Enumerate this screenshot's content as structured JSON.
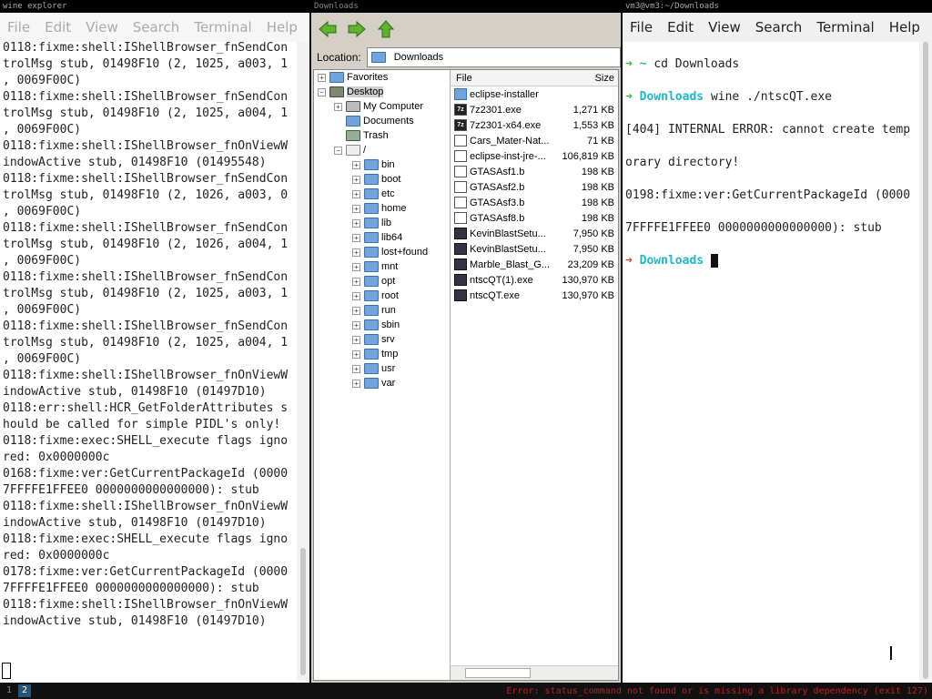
{
  "left_terminal": {
    "title": "wine explorer",
    "menu": [
      "File",
      "Edit",
      "View",
      "Search",
      "Terminal",
      "Help"
    ],
    "lines": [
      "0118:fixme:shell:IShellBrowser_fnSendCon",
      "trolMsg stub, 01498F10 (2, 1025, a003, 1",
      ", 0069F00C)",
      "0118:fixme:shell:IShellBrowser_fnSendCon",
      "trolMsg stub, 01498F10 (2, 1025, a004, 1",
      ", 0069F00C)",
      "0118:fixme:shell:IShellBrowser_fnOnViewW",
      "indowActive stub, 01498F10 (01495548)",
      "0118:fixme:shell:IShellBrowser_fnSendCon",
      "trolMsg stub, 01498F10 (2, 1026, a003, 0",
      ", 0069F00C)",
      "0118:fixme:shell:IShellBrowser_fnSendCon",
      "trolMsg stub, 01498F10 (2, 1026, a004, 1",
      ", 0069F00C)",
      "0118:fixme:shell:IShellBrowser_fnSendCon",
      "trolMsg stub, 01498F10 (2, 1025, a003, 1",
      ", 0069F00C)",
      "0118:fixme:shell:IShellBrowser_fnSendCon",
      "trolMsg stub, 01498F10 (2, 1025, a004, 1",
      ", 0069F00C)",
      "0118:fixme:shell:IShellBrowser_fnOnViewW",
      "indowActive stub, 01498F10 (01497D10)",
      "0118:err:shell:HCR_GetFolderAttributes s",
      "hould be called for simple PIDL's only!",
      "0118:fixme:exec:SHELL_execute flags igno",
      "red: 0x0000000c",
      "0168:fixme:ver:GetCurrentPackageId (0000",
      "7FFFFE1FFEE0 0000000000000000): stub",
      "0118:fixme:shell:IShellBrowser_fnOnViewW",
      "indowActive stub, 01498F10 (01497D10)",
      "0118:fixme:exec:SHELL_execute flags igno",
      "red: 0x0000000c",
      "0178:fixme:ver:GetCurrentPackageId (0000",
      "7FFFFE1FFEE0 0000000000000000): stub",
      "0118:fixme:shell:IShellBrowser_fnOnViewW",
      "indowActive stub, 01498F10 (01497D10)"
    ]
  },
  "explorer": {
    "title": "Downloads",
    "location_label": "Location:",
    "location_value": "Downloads",
    "tree": {
      "favorites": "Favorites",
      "desktop": "Desktop",
      "my_computer": "My Computer",
      "documents": "Documents",
      "trash": "Trash",
      "root": "/",
      "folders": [
        "bin",
        "boot",
        "etc",
        "home",
        "lib",
        "lib64",
        "lost+found",
        "mnt",
        "opt",
        "root",
        "run",
        "sbin",
        "srv",
        "tmp",
        "usr",
        "var"
      ]
    },
    "columns": {
      "file": "File",
      "size": "Size"
    },
    "files": [
      {
        "name": "eclipse-installer",
        "size": "",
        "icon": "folder"
      },
      {
        "name": "7z2301.exe",
        "size": "1,271 KB",
        "icon": "7z"
      },
      {
        "name": "7z2301-x64.exe",
        "size": "1,553 KB",
        "icon": "7z"
      },
      {
        "name": "Cars_Mater-Nat...",
        "size": "71 KB",
        "icon": "doc"
      },
      {
        "name": "eclipse-inst-jre-...",
        "size": "106,819 KB",
        "icon": "doc"
      },
      {
        "name": "GTASAsf1.b",
        "size": "198 KB",
        "icon": "doc"
      },
      {
        "name": "GTASAsf2.b",
        "size": "198 KB",
        "icon": "doc"
      },
      {
        "name": "GTASAsf3.b",
        "size": "198 KB",
        "icon": "doc"
      },
      {
        "name": "GTASAsf8.b",
        "size": "198 KB",
        "icon": "doc"
      },
      {
        "name": "KevinBlastSetu...",
        "size": "7,950 KB",
        "icon": "exe"
      },
      {
        "name": "KevinBlastSetu...",
        "size": "7,950 KB",
        "icon": "exe"
      },
      {
        "name": "Marble_Blast_G...",
        "size": "23,209 KB",
        "icon": "exe"
      },
      {
        "name": "ntscQT(1).exe",
        "size": "130,970 KB",
        "icon": "exe"
      },
      {
        "name": "ntscQT.exe",
        "size": "130,970 KB",
        "icon": "exe"
      }
    ]
  },
  "right_terminal": {
    "title": "vm3@vm3:~/Downloads",
    "menu": [
      "File",
      "Edit",
      "View",
      "Search",
      "Terminal",
      "Help"
    ],
    "prompt1_arrow": "➜",
    "prompt1_dir": "~",
    "prompt1_cmd": "cd Downloads",
    "prompt2_arrow": "➜",
    "prompt2_dir": "Downloads",
    "prompt2_cmd": "wine ./ntscQT.exe",
    "output1": "[404] INTERNAL ERROR: cannot create temp",
    "output2": "orary directory!",
    "output3": "0198:fixme:ver:GetCurrentPackageId (0000",
    "output4": "7FFFFE1FFEE0 0000000000000000): stub",
    "prompt3_arrow": "➜",
    "prompt3_dir": "Downloads"
  },
  "taskbar": {
    "workspaces": [
      "1",
      "2"
    ],
    "active_workspace": "2",
    "status": "Error: status_command not found or is missing a library dependency (exit 127)"
  }
}
